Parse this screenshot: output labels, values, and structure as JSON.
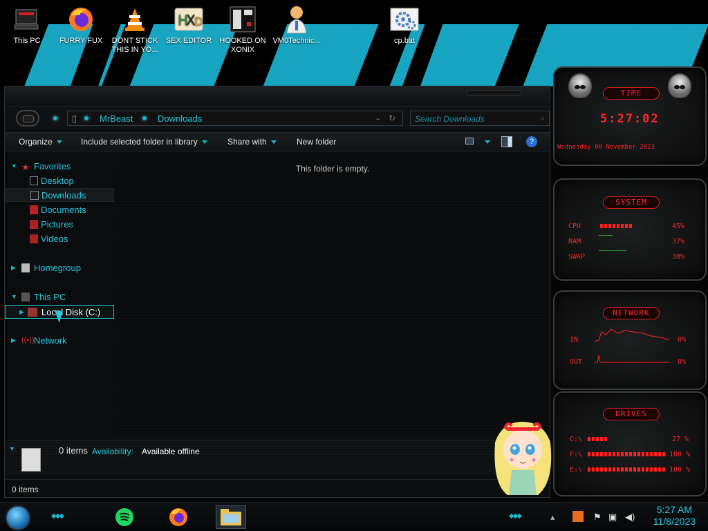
{
  "desktop": {
    "icons": [
      {
        "label": "This PC",
        "icon": "computer-icon"
      },
      {
        "label": "FURRY FUX",
        "icon": "firefox-icon"
      },
      {
        "label": "DONT STICK THIS IN YO...",
        "icon": "vlc-icon"
      },
      {
        "label": "SEX EDITOR",
        "icon": "hxd-icon"
      },
      {
        "label": "HOOKED ON XONIX",
        "icon": "xonix-icon"
      },
      {
        "label": "VM0Technic...",
        "icon": "doctor-icon"
      },
      {
        "label": "cp.bat",
        "icon": "batch-gear-icon"
      }
    ]
  },
  "explorer": {
    "breadcrumb": [
      "MrBeast",
      "Downloads"
    ],
    "search_placeholder": "Search Downloads",
    "toolbar": {
      "organize": "Organize",
      "include": "Include selected folder in library",
      "share": "Share with",
      "new_folder": "New folder"
    },
    "nav": {
      "favorites": "Favorites",
      "desktop": "Desktop",
      "downloads": "Downloads",
      "documents": "Documents",
      "pictures": "Pictures",
      "videos": "Videos",
      "homegroup": "Homegroup",
      "this_pc": "This PC",
      "local_disk": "Local Disk (C:)",
      "network": "Network"
    },
    "empty_message": "This folder is empty.",
    "details": {
      "items": "0 items",
      "availability_label": "Availability:",
      "availability_value": "Available offline"
    },
    "status": "0 items"
  },
  "gadgets": {
    "time": {
      "header": "TIME",
      "clock": "5:27:02",
      "date": "Wednesday 08 November 2023"
    },
    "system": {
      "header": "SYSTEM",
      "rows": [
        {
          "label": "CPU",
          "value": "45%"
        },
        {
          "label": "RAM",
          "value": "37%"
        },
        {
          "label": "SWAP",
          "value": "38%"
        }
      ]
    },
    "network": {
      "header": "NETWORK",
      "rows": [
        {
          "label": "IN",
          "value": "0%"
        },
        {
          "label": "OUT",
          "value": "0%"
        }
      ]
    },
    "drives": {
      "header": "DRIVES",
      "rows": [
        {
          "label": "C:\\",
          "value": "27 %"
        },
        {
          "label": "F:\\",
          "value": "100 %"
        },
        {
          "label": "E:\\",
          "value": "100 %"
        }
      ]
    }
  },
  "taskbar": {
    "time": "5:27 AM",
    "date": "11/8/2023",
    "pinned": [
      "spotify-icon",
      "firefox-icon",
      "file-explorer-icon"
    ]
  },
  "colors": {
    "accent": "#29c6dc",
    "gadget_red": "#ff2626",
    "background": "#0b0d0f"
  }
}
